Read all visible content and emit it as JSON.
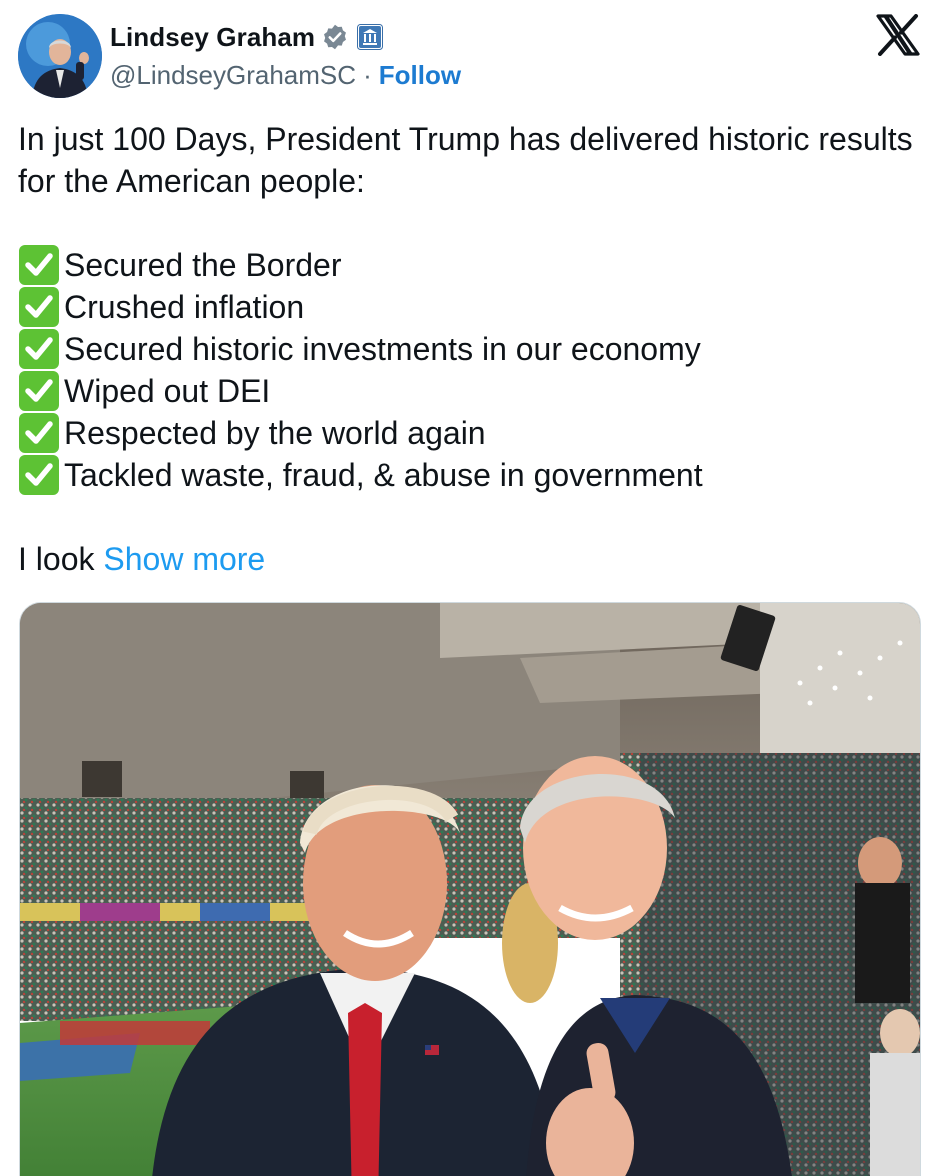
{
  "author": {
    "display_name": "Lindsey Graham",
    "handle": "@LindseyGrahamSC",
    "separator": "·",
    "follow_label": "Follow",
    "verified_icon": "verified-badge-icon",
    "affiliation_icon": "government-building-icon",
    "avatar_icon": "profile-avatar"
  },
  "platform": {
    "logo_icon": "x-logo-icon"
  },
  "tweet": {
    "intro": "In just 100 Days, President Trump has delivered historic results for the American people:",
    "checklist": [
      "Secured the Border",
      "Crushed inflation",
      "Secured historic investments in our economy",
      "Wiped out DEI",
      "Respected by the world again",
      "Tackled waste, fraud, & abuse in government"
    ],
    "truncated_text": "I look",
    "show_more_label": "Show more",
    "check_icon": "white-check-mark-icon"
  },
  "colors": {
    "link": "#1d9bf0",
    "follow": "#1d7bd1",
    "text": "#0f1419",
    "secondary": "#536471",
    "check": "#5dc234"
  }
}
